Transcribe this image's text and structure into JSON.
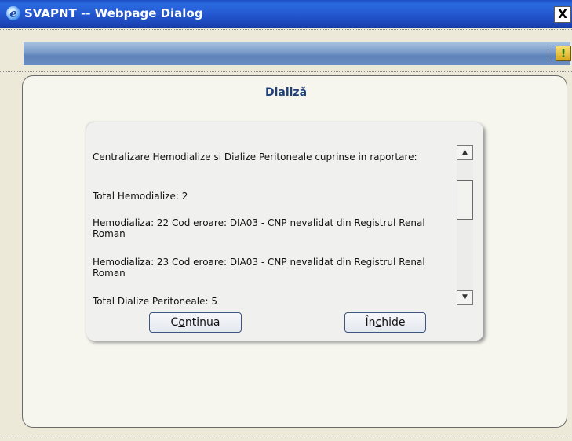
{
  "window": {
    "title": "SVAPNT -- Webpage Dialog",
    "close_label": "X",
    "icon": "ie-icon"
  },
  "toolbar": {
    "help_icon": "help-icon",
    "help_symbol": "!"
  },
  "panel": {
    "title": "Dializă"
  },
  "message": {
    "lines": [
      "Centralizare Hemodialize si Dialize Peritoneale cuprinse in raportare:",
      "Total Hemodialize: 2",
      "Hemodializa: 22 Cod eroare: DIA03 - CNP nevalidat din Registrul Renal Roman",
      "Hemodializa: 23 Cod eroare: DIA03 - CNP nevalidat din Registrul Renal Roman",
      "Total Dialize Peritoneale: 5"
    ]
  },
  "scrollbar": {
    "up_icon": "scroll-up-arrow-icon",
    "down_icon": "scroll-down-arrow-icon"
  },
  "buttons": {
    "continua_pre": "C",
    "continua_accel": "o",
    "continua_post": "ntinua",
    "inchide_pre": "În",
    "inchide_accel": "c",
    "inchide_post": "hide"
  }
}
